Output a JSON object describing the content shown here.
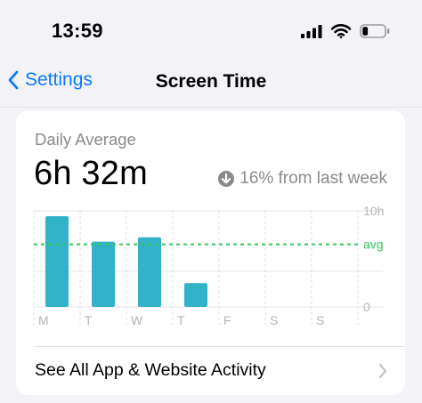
{
  "status_bar": {
    "time": "13:59",
    "battery_level": 0.25
  },
  "nav": {
    "back_label": "Settings",
    "title": "Screen Time"
  },
  "summary": {
    "caption": "Daily Average",
    "value": "6h 32m",
    "delta_text": "16% from last week",
    "delta_icon": "arrow-down-circle-icon"
  },
  "colors": {
    "accent": "#0a7aff",
    "bar": "#31b2c8",
    "average_line": "#34c759",
    "secondary_text": "#8a8a8e"
  },
  "chart_data": {
    "type": "bar",
    "categories": [
      "M",
      "T",
      "W",
      "T",
      "F",
      "S",
      "S"
    ],
    "values": [
      10.3,
      7.4,
      7.9,
      2.7,
      0,
      0,
      0
    ],
    "average": 7.1,
    "average_label": "avg",
    "y_ticks": [
      "10h",
      "0"
    ],
    "ylim": [
      0,
      10.9
    ]
  },
  "activity": {
    "label": "See All App & Website Activity"
  }
}
